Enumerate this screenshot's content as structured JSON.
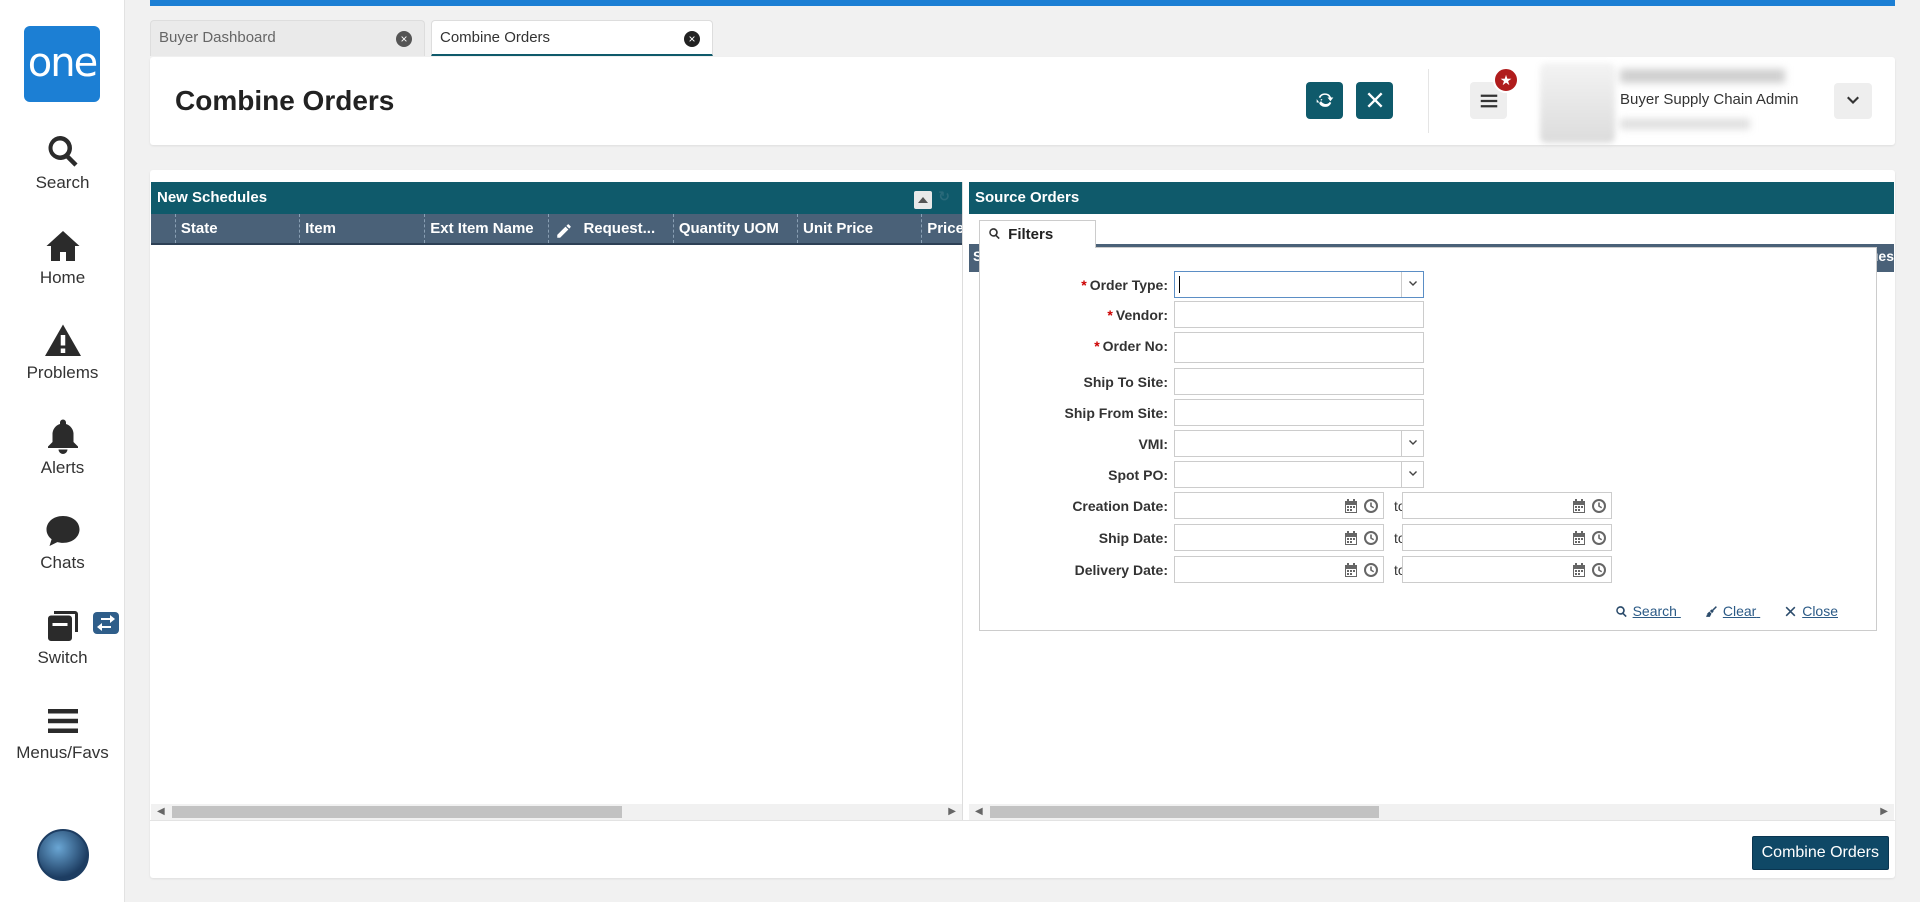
{
  "app": {
    "logo_text": "one",
    "accent": "#1c7fd4",
    "primary": "#0f5a6b"
  },
  "nav": [
    {
      "label": "Search",
      "icon": "search-icon"
    },
    {
      "label": "Home",
      "icon": "home-icon"
    },
    {
      "label": "Problems",
      "icon": "warning-icon"
    },
    {
      "label": "Alerts",
      "icon": "bell-icon"
    },
    {
      "label": "Chats",
      "icon": "chat-icon"
    },
    {
      "label": "Switch",
      "icon": "switch-icon"
    },
    {
      "label": "Menus/Favs",
      "icon": "hamburger-icon"
    }
  ],
  "tabs": [
    {
      "label": "Buyer Dashboard"
    },
    {
      "label": "Combine Orders"
    }
  ],
  "header": {
    "title": "Combine Orders",
    "user_role": "Buyer Supply Chain Admin"
  },
  "left_panel": {
    "title": "New Schedules",
    "columns": [
      "",
      "State",
      "Item",
      "Ext Item Name",
      "Request...",
      "Quantity UOM",
      "Unit Price",
      "Price"
    ]
  },
  "right_panel": {
    "title": "Source Orders",
    "filter_tab": "Filters",
    "under_left": "S",
    "under_right": "ues",
    "fields": {
      "order_type": "Order Type:",
      "vendor": "Vendor:",
      "order_no": "Order No:",
      "ship_to_site": "Ship To Site:",
      "ship_from_site": "Ship From Site:",
      "vmi": "VMI:",
      "spot_po": "Spot PO:",
      "creation_date": "Creation Date:",
      "ship_date": "Ship Date:",
      "delivery_date": "Delivery Date:"
    },
    "to_label": "to",
    "actions": {
      "search": "Search",
      "clear": "Clear",
      "close": "Close"
    }
  },
  "footer": {
    "combine_button": "Combine Orders"
  }
}
